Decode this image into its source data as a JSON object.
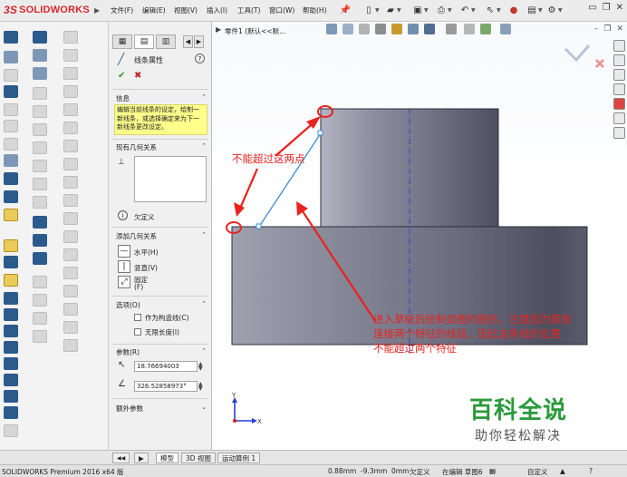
{
  "app": {
    "logo_brand": "SOLIDWORKS",
    "logo_ds": "3S",
    "menu": [
      "文件(F)",
      "编辑(E)",
      "视图(V)",
      "插入(I)",
      "工具(T)",
      "窗口(W)",
      "帮助(H)"
    ]
  },
  "property_manager": {
    "title": "线条属性",
    "help": "?",
    "ok": "✔",
    "cancel": "✖",
    "info": {
      "heading": "信息",
      "text": "编辑当前线条的设定，绘制一新线条，或选择确定来为下一新线条更改设定。"
    },
    "existing_relations": {
      "heading": "现有几何关系",
      "status": "欠定义"
    },
    "add_relations": {
      "heading": "添加几何关系",
      "items": [
        "水平(H)",
        "竖直(V)",
        "固定",
        "(F)"
      ]
    },
    "options": {
      "heading": "选项(O)",
      "items": [
        "作为构造线(C)",
        "无限长度(I)"
      ]
    },
    "parameters": {
      "heading": "参数(R)",
      "length": "18.76694003",
      "angle": "326.52858973°"
    },
    "extra": {
      "heading": "额外参数"
    }
  },
  "graphics": {
    "breadcrumb": "零件1 (默认<<默...",
    "annotation_1": "不能超过这两点",
    "annotation_2_lines": [
      "进入草绘后绘制如图的图形，注意因为那是",
      "连接两个特征的线段，因此这条线的位置",
      "不能超过两个特征"
    ],
    "watermark_title": "百科全说",
    "watermark_sub": "助你轻松解决",
    "triad_y": "Y",
    "triad_x": "X"
  },
  "bottom_tabs": [
    "模型",
    "3D 视图",
    "运动算例 1"
  ],
  "status_bar": {
    "app_version": "SOLIDWORKS Premium 2016 x64 版",
    "x": "0.88mm",
    "y": "-9.3mm",
    "z": "0mm",
    "definition": "欠定义",
    "editing": "在编辑 草图6",
    "units": "自定义"
  },
  "colors": {
    "brand_red": "#d6282d",
    "annotation_red": "#e8231f",
    "sketch_blue": "#3a8fd8",
    "watermark_green": "#2a9a3a"
  }
}
